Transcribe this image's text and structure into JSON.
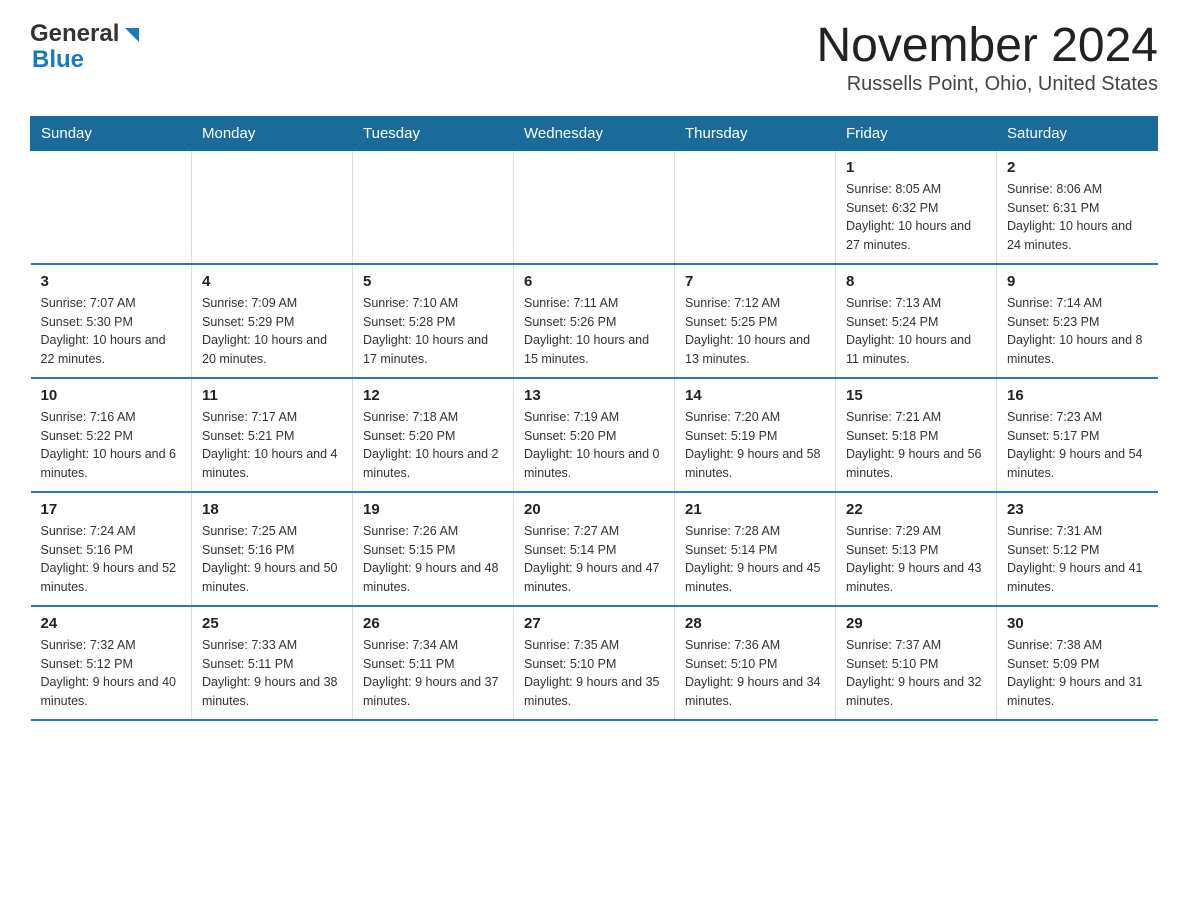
{
  "logo": {
    "general": "General",
    "blue": "Blue"
  },
  "title": "November 2024",
  "subtitle": "Russells Point, Ohio, United States",
  "weekdays": [
    "Sunday",
    "Monday",
    "Tuesday",
    "Wednesday",
    "Thursday",
    "Friday",
    "Saturday"
  ],
  "weeks": [
    [
      {
        "day": "",
        "sunrise": "",
        "sunset": "",
        "daylight": ""
      },
      {
        "day": "",
        "sunrise": "",
        "sunset": "",
        "daylight": ""
      },
      {
        "day": "",
        "sunrise": "",
        "sunset": "",
        "daylight": ""
      },
      {
        "day": "",
        "sunrise": "",
        "sunset": "",
        "daylight": ""
      },
      {
        "day": "",
        "sunrise": "",
        "sunset": "",
        "daylight": ""
      },
      {
        "day": "1",
        "sunrise": "Sunrise: 8:05 AM",
        "sunset": "Sunset: 6:32 PM",
        "daylight": "Daylight: 10 hours and 27 minutes."
      },
      {
        "day": "2",
        "sunrise": "Sunrise: 8:06 AM",
        "sunset": "Sunset: 6:31 PM",
        "daylight": "Daylight: 10 hours and 24 minutes."
      }
    ],
    [
      {
        "day": "3",
        "sunrise": "Sunrise: 7:07 AM",
        "sunset": "Sunset: 5:30 PM",
        "daylight": "Daylight: 10 hours and 22 minutes."
      },
      {
        "day": "4",
        "sunrise": "Sunrise: 7:09 AM",
        "sunset": "Sunset: 5:29 PM",
        "daylight": "Daylight: 10 hours and 20 minutes."
      },
      {
        "day": "5",
        "sunrise": "Sunrise: 7:10 AM",
        "sunset": "Sunset: 5:28 PM",
        "daylight": "Daylight: 10 hours and 17 minutes."
      },
      {
        "day": "6",
        "sunrise": "Sunrise: 7:11 AM",
        "sunset": "Sunset: 5:26 PM",
        "daylight": "Daylight: 10 hours and 15 minutes."
      },
      {
        "day": "7",
        "sunrise": "Sunrise: 7:12 AM",
        "sunset": "Sunset: 5:25 PM",
        "daylight": "Daylight: 10 hours and 13 minutes."
      },
      {
        "day": "8",
        "sunrise": "Sunrise: 7:13 AM",
        "sunset": "Sunset: 5:24 PM",
        "daylight": "Daylight: 10 hours and 11 minutes."
      },
      {
        "day": "9",
        "sunrise": "Sunrise: 7:14 AM",
        "sunset": "Sunset: 5:23 PM",
        "daylight": "Daylight: 10 hours and 8 minutes."
      }
    ],
    [
      {
        "day": "10",
        "sunrise": "Sunrise: 7:16 AM",
        "sunset": "Sunset: 5:22 PM",
        "daylight": "Daylight: 10 hours and 6 minutes."
      },
      {
        "day": "11",
        "sunrise": "Sunrise: 7:17 AM",
        "sunset": "Sunset: 5:21 PM",
        "daylight": "Daylight: 10 hours and 4 minutes."
      },
      {
        "day": "12",
        "sunrise": "Sunrise: 7:18 AM",
        "sunset": "Sunset: 5:20 PM",
        "daylight": "Daylight: 10 hours and 2 minutes."
      },
      {
        "day": "13",
        "sunrise": "Sunrise: 7:19 AM",
        "sunset": "Sunset: 5:20 PM",
        "daylight": "Daylight: 10 hours and 0 minutes."
      },
      {
        "day": "14",
        "sunrise": "Sunrise: 7:20 AM",
        "sunset": "Sunset: 5:19 PM",
        "daylight": "Daylight: 9 hours and 58 minutes."
      },
      {
        "day": "15",
        "sunrise": "Sunrise: 7:21 AM",
        "sunset": "Sunset: 5:18 PM",
        "daylight": "Daylight: 9 hours and 56 minutes."
      },
      {
        "day": "16",
        "sunrise": "Sunrise: 7:23 AM",
        "sunset": "Sunset: 5:17 PM",
        "daylight": "Daylight: 9 hours and 54 minutes."
      }
    ],
    [
      {
        "day": "17",
        "sunrise": "Sunrise: 7:24 AM",
        "sunset": "Sunset: 5:16 PM",
        "daylight": "Daylight: 9 hours and 52 minutes."
      },
      {
        "day": "18",
        "sunrise": "Sunrise: 7:25 AM",
        "sunset": "Sunset: 5:16 PM",
        "daylight": "Daylight: 9 hours and 50 minutes."
      },
      {
        "day": "19",
        "sunrise": "Sunrise: 7:26 AM",
        "sunset": "Sunset: 5:15 PM",
        "daylight": "Daylight: 9 hours and 48 minutes."
      },
      {
        "day": "20",
        "sunrise": "Sunrise: 7:27 AM",
        "sunset": "Sunset: 5:14 PM",
        "daylight": "Daylight: 9 hours and 47 minutes."
      },
      {
        "day": "21",
        "sunrise": "Sunrise: 7:28 AM",
        "sunset": "Sunset: 5:14 PM",
        "daylight": "Daylight: 9 hours and 45 minutes."
      },
      {
        "day": "22",
        "sunrise": "Sunrise: 7:29 AM",
        "sunset": "Sunset: 5:13 PM",
        "daylight": "Daylight: 9 hours and 43 minutes."
      },
      {
        "day": "23",
        "sunrise": "Sunrise: 7:31 AM",
        "sunset": "Sunset: 5:12 PM",
        "daylight": "Daylight: 9 hours and 41 minutes."
      }
    ],
    [
      {
        "day": "24",
        "sunrise": "Sunrise: 7:32 AM",
        "sunset": "Sunset: 5:12 PM",
        "daylight": "Daylight: 9 hours and 40 minutes."
      },
      {
        "day": "25",
        "sunrise": "Sunrise: 7:33 AM",
        "sunset": "Sunset: 5:11 PM",
        "daylight": "Daylight: 9 hours and 38 minutes."
      },
      {
        "day": "26",
        "sunrise": "Sunrise: 7:34 AM",
        "sunset": "Sunset: 5:11 PM",
        "daylight": "Daylight: 9 hours and 37 minutes."
      },
      {
        "day": "27",
        "sunrise": "Sunrise: 7:35 AM",
        "sunset": "Sunset: 5:10 PM",
        "daylight": "Daylight: 9 hours and 35 minutes."
      },
      {
        "day": "28",
        "sunrise": "Sunrise: 7:36 AM",
        "sunset": "Sunset: 5:10 PM",
        "daylight": "Daylight: 9 hours and 34 minutes."
      },
      {
        "day": "29",
        "sunrise": "Sunrise: 7:37 AM",
        "sunset": "Sunset: 5:10 PM",
        "daylight": "Daylight: 9 hours and 32 minutes."
      },
      {
        "day": "30",
        "sunrise": "Sunrise: 7:38 AM",
        "sunset": "Sunset: 5:09 PM",
        "daylight": "Daylight: 9 hours and 31 minutes."
      }
    ]
  ]
}
